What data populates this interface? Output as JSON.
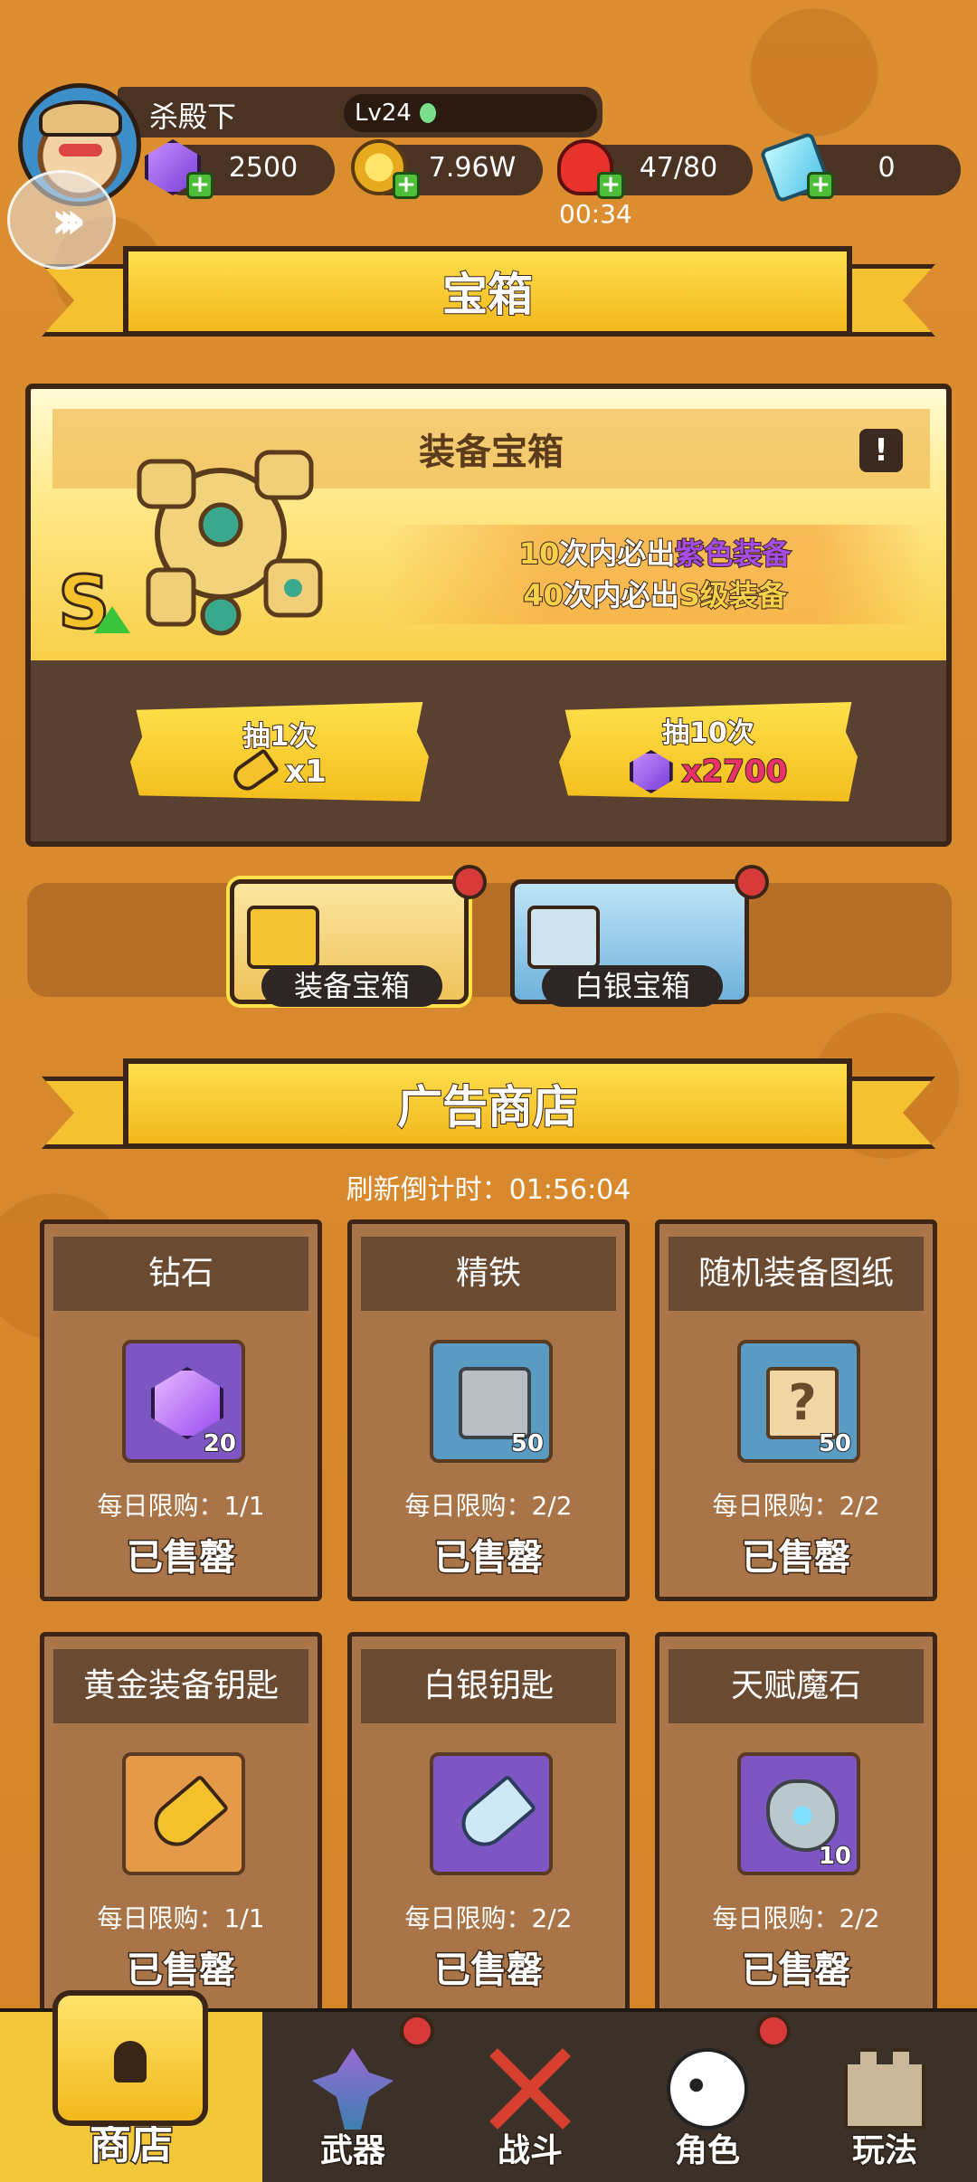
{
  "header": {
    "player_name": "杀殿下",
    "level": "Lv24",
    "resources": {
      "gems": "2500",
      "gold": "7.96W",
      "stamina": "47/80",
      "stamina_timer": "00:34",
      "tickets": "0"
    }
  },
  "chest_section": {
    "banner_title": "宝箱",
    "panel_title": "装备宝箱",
    "info_icon": "!",
    "guarantee": {
      "line1_num": "10",
      "line1_mid": "次内必出",
      "line1_highlight": "紫色装备",
      "line2_num": "40",
      "line2_mid": "次内必出",
      "line2_highlight": "S级装备"
    },
    "s_badge": "S",
    "draw_one": {
      "label": "抽1次",
      "cost": "x1"
    },
    "draw_ten": {
      "label": "抽10次",
      "cost": "x2700"
    },
    "tabs": [
      {
        "label": "装备宝箱",
        "active": true
      },
      {
        "label": "白银宝箱",
        "active": false
      }
    ]
  },
  "ad_shop": {
    "banner_title": "广告商店",
    "refresh_label": "刷新倒计时：01:56:04",
    "items": [
      {
        "name": "钻石",
        "qty": "20",
        "limit": "每日限购：1/1",
        "status": "已售罄",
        "icon": "gem-icon",
        "color": "#7e56c4"
      },
      {
        "name": "精铁",
        "qty": "50",
        "limit": "每日限购：2/2",
        "status": "已售罄",
        "icon": "iron-icon",
        "color": "#5a9bc4"
      },
      {
        "name": "随机装备图纸",
        "qty": "50",
        "limit": "每日限购：2/2",
        "status": "已售罄",
        "icon": "scroll-icon",
        "color": "#5a9bc4"
      },
      {
        "name": "黄金装备钥匙",
        "qty": "",
        "limit": "每日限购：1/1",
        "status": "已售罄",
        "icon": "gold-key-icon",
        "color": "#e59a4a"
      },
      {
        "name": "白银钥匙",
        "qty": "",
        "limit": "每日限购：2/2",
        "status": "已售罄",
        "icon": "silver-key-icon",
        "color": "#7e56c4"
      },
      {
        "name": "天赋魔石",
        "qty": "10",
        "limit": "每日限购：2/2",
        "status": "已售罄",
        "icon": "stone-icon",
        "color": "#7e56c4"
      }
    ],
    "scroll_glyph": "?"
  },
  "nav": {
    "items": [
      {
        "label": "商店",
        "active": true
      },
      {
        "label": "武器",
        "active": false,
        "badge": true
      },
      {
        "label": "战斗",
        "active": false
      },
      {
        "label": "角色",
        "active": false,
        "badge": true
      },
      {
        "label": "玩法",
        "active": false
      }
    ]
  },
  "colors": {
    "background": "#d98a2b",
    "ribbon": "#f4c131",
    "panel": "#a97548",
    "nav_active": "#f2c83a",
    "badge_red": "#d83a3a"
  }
}
